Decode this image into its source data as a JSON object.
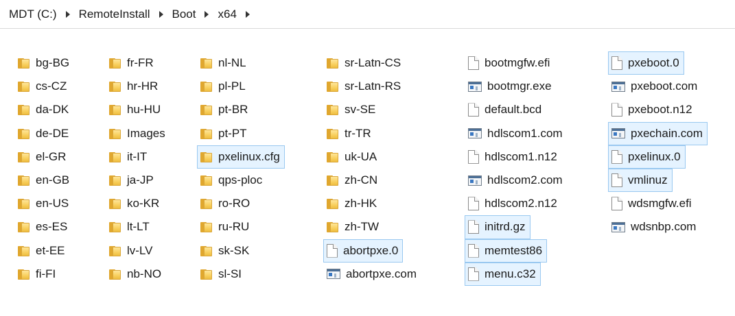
{
  "breadcrumb": [
    "MDT (C:)",
    "RemoteInstall",
    "Boot",
    "x64"
  ],
  "columns": [
    {
      "items": [
        {
          "name": "bg-BG",
          "type": "folder"
        },
        {
          "name": "cs-CZ",
          "type": "folder"
        },
        {
          "name": "da-DK",
          "type": "folder"
        },
        {
          "name": "de-DE",
          "type": "folder"
        },
        {
          "name": "el-GR",
          "type": "folder"
        },
        {
          "name": "en-GB",
          "type": "folder"
        },
        {
          "name": "en-US",
          "type": "folder"
        },
        {
          "name": "es-ES",
          "type": "folder"
        },
        {
          "name": "et-EE",
          "type": "folder"
        },
        {
          "name": "fi-FI",
          "type": "folder"
        }
      ]
    },
    {
      "items": [
        {
          "name": "fr-FR",
          "type": "folder"
        },
        {
          "name": "hr-HR",
          "type": "folder"
        },
        {
          "name": "hu-HU",
          "type": "folder"
        },
        {
          "name": "Images",
          "type": "folder"
        },
        {
          "name": "it-IT",
          "type": "folder"
        },
        {
          "name": "ja-JP",
          "type": "folder"
        },
        {
          "name": "ko-KR",
          "type": "folder"
        },
        {
          "name": "lt-LT",
          "type": "folder"
        },
        {
          "name": "lv-LV",
          "type": "folder"
        },
        {
          "name": "nb-NO",
          "type": "folder"
        }
      ]
    },
    {
      "items": [
        {
          "name": "nl-NL",
          "type": "folder"
        },
        {
          "name": "pl-PL",
          "type": "folder"
        },
        {
          "name": "pt-BR",
          "type": "folder"
        },
        {
          "name": "pt-PT",
          "type": "folder"
        },
        {
          "name": "pxelinux.cfg",
          "type": "folder",
          "selected": true
        },
        {
          "name": "qps-ploc",
          "type": "folder"
        },
        {
          "name": "ro-RO",
          "type": "folder"
        },
        {
          "name": "ru-RU",
          "type": "folder"
        },
        {
          "name": "sk-SK",
          "type": "folder"
        },
        {
          "name": "sl-SI",
          "type": "folder"
        }
      ]
    },
    {
      "items": [
        {
          "name": "sr-Latn-CS",
          "type": "folder"
        },
        {
          "name": "sr-Latn-RS",
          "type": "folder"
        },
        {
          "name": "sv-SE",
          "type": "folder"
        },
        {
          "name": "tr-TR",
          "type": "folder"
        },
        {
          "name": "uk-UA",
          "type": "folder"
        },
        {
          "name": "zh-CN",
          "type": "folder"
        },
        {
          "name": "zh-HK",
          "type": "folder"
        },
        {
          "name": "zh-TW",
          "type": "folder"
        },
        {
          "name": "abortpxe.0",
          "type": "file",
          "selected": true
        },
        {
          "name": "abortpxe.com",
          "type": "exe"
        }
      ]
    },
    {
      "items": [
        {
          "name": "bootmgfw.efi",
          "type": "file"
        },
        {
          "name": "bootmgr.exe",
          "type": "exe"
        },
        {
          "name": "default.bcd",
          "type": "file"
        },
        {
          "name": "hdlscom1.com",
          "type": "exe"
        },
        {
          "name": "hdlscom1.n12",
          "type": "file"
        },
        {
          "name": "hdlscom2.com",
          "type": "exe"
        },
        {
          "name": "hdlscom2.n12",
          "type": "file"
        },
        {
          "name": "initrd.gz",
          "type": "file",
          "selected": true
        },
        {
          "name": "memtest86",
          "type": "file",
          "selected": true
        },
        {
          "name": "menu.c32",
          "type": "file",
          "selected": true
        }
      ]
    },
    {
      "items": [
        {
          "name": "pxeboot.0",
          "type": "file",
          "selected": true
        },
        {
          "name": "pxeboot.com",
          "type": "exe"
        },
        {
          "name": "pxeboot.n12",
          "type": "file"
        },
        {
          "name": "pxechain.com",
          "type": "exe",
          "selected": true
        },
        {
          "name": "pxelinux.0",
          "type": "file",
          "selected": true
        },
        {
          "name": "vmlinuz",
          "type": "file",
          "selected": true
        },
        {
          "name": "wdsmgfw.efi",
          "type": "file"
        },
        {
          "name": "wdsnbp.com",
          "type": "exe"
        }
      ]
    }
  ]
}
